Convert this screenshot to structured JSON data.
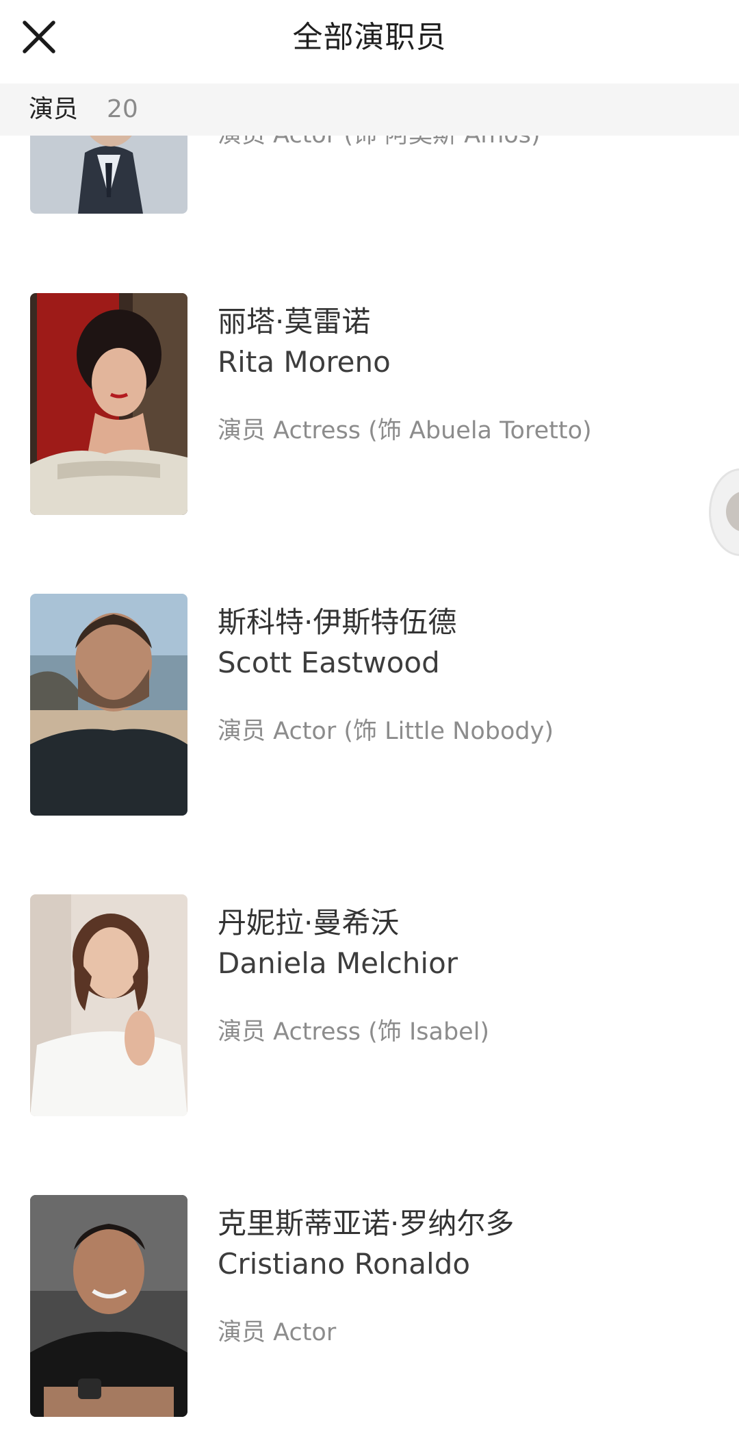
{
  "header": {
    "title": "全部演职员",
    "close_icon": "close-icon"
  },
  "section": {
    "label": "演员",
    "count": "20"
  },
  "partial": {
    "role": "演员 Actor (饰 阿莫斯 Amos)"
  },
  "cast": [
    {
      "cn": "丽塔·莫雷诺",
      "en": "Rita Moreno",
      "role": "演员 Actress (饰 Abuela Toretto)"
    },
    {
      "cn": "斯科特·伊斯特伍德",
      "en": "Scott Eastwood",
      "role": "演员 Actor (饰 Little Nobody)"
    },
    {
      "cn": "丹妮拉·曼希沃",
      "en": "Daniela Melchior",
      "role": "演员 Actress (饰 Isabel)"
    },
    {
      "cn": "克里斯蒂亚诺·罗纳尔多",
      "en": "Cristiano Ronaldo",
      "role": "演员 Actor"
    }
  ]
}
